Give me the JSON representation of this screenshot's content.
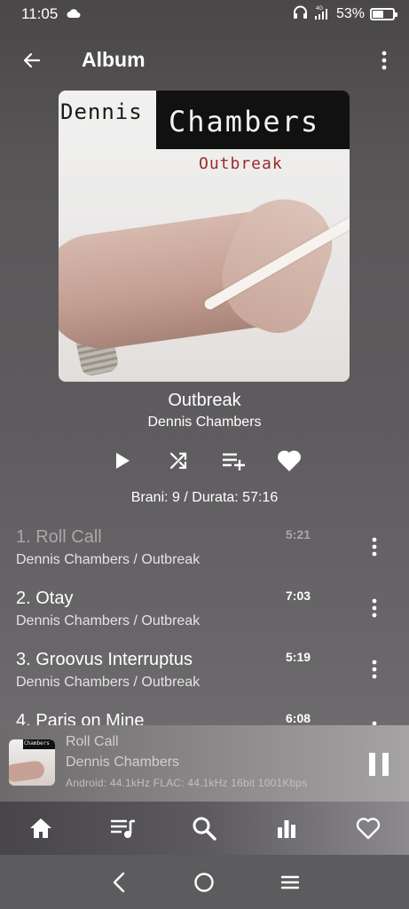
{
  "status_bar": {
    "time": "11:05",
    "network": "4G",
    "battery_percent": "53%",
    "battery_level": 0.53,
    "icons": [
      "cloud-icon",
      "headphones-icon",
      "signal-icon",
      "battery-icon"
    ]
  },
  "header": {
    "title": "Album",
    "back_icon": "arrow-left-icon",
    "menu_icon": "more-vertical-icon"
  },
  "cover_art": {
    "text_line1": "Dennis",
    "text_line2": "Chambers",
    "text_line3": "Outbreak"
  },
  "album": {
    "title": "Outbreak",
    "artist": "Dennis Chambers",
    "info": "Brani: 9 / Durata: 57:16"
  },
  "actions": [
    {
      "icon": "play-icon"
    },
    {
      "icon": "shuffle-icon"
    },
    {
      "icon": "add-to-playlist-icon"
    },
    {
      "icon": "heart-icon"
    }
  ],
  "tracks": [
    {
      "title": "1. Roll Call",
      "subtitle": "Dennis Chambers / Outbreak",
      "duration": "5:21",
      "playing": true
    },
    {
      "title": "2. Otay",
      "subtitle": "Dennis Chambers / Outbreak",
      "duration": "7:03",
      "playing": false
    },
    {
      "title": "3. Groovus Interruptus",
      "subtitle": "Dennis Chambers / Outbreak",
      "duration": "5:19",
      "playing": false
    },
    {
      "title": "4. Paris on Mine",
      "subtitle": "",
      "duration": "6:08",
      "playing": false
    }
  ],
  "mini_player": {
    "title": "Roll Call",
    "artist": "Dennis Chambers",
    "meta": "Android: 44.1kHz  FLAC: 44.1kHz  16bit   1001Kbps",
    "cover_text": "Chambers",
    "pause_icon": "pause-icon"
  },
  "bottom_nav": [
    {
      "icon": "home-icon"
    },
    {
      "icon": "queue-music-icon"
    },
    {
      "icon": "search-icon"
    },
    {
      "icon": "equalizer-icon"
    },
    {
      "icon": "favorite-outline-icon"
    }
  ],
  "system_nav": [
    {
      "icon": "back-chevron-icon"
    },
    {
      "icon": "home-circle-icon"
    },
    {
      "icon": "recents-menu-icon"
    }
  ],
  "colors": {
    "text": "#ffffff",
    "playing_text": "#a9a7a8",
    "cover_red": "#9c2a2a"
  }
}
